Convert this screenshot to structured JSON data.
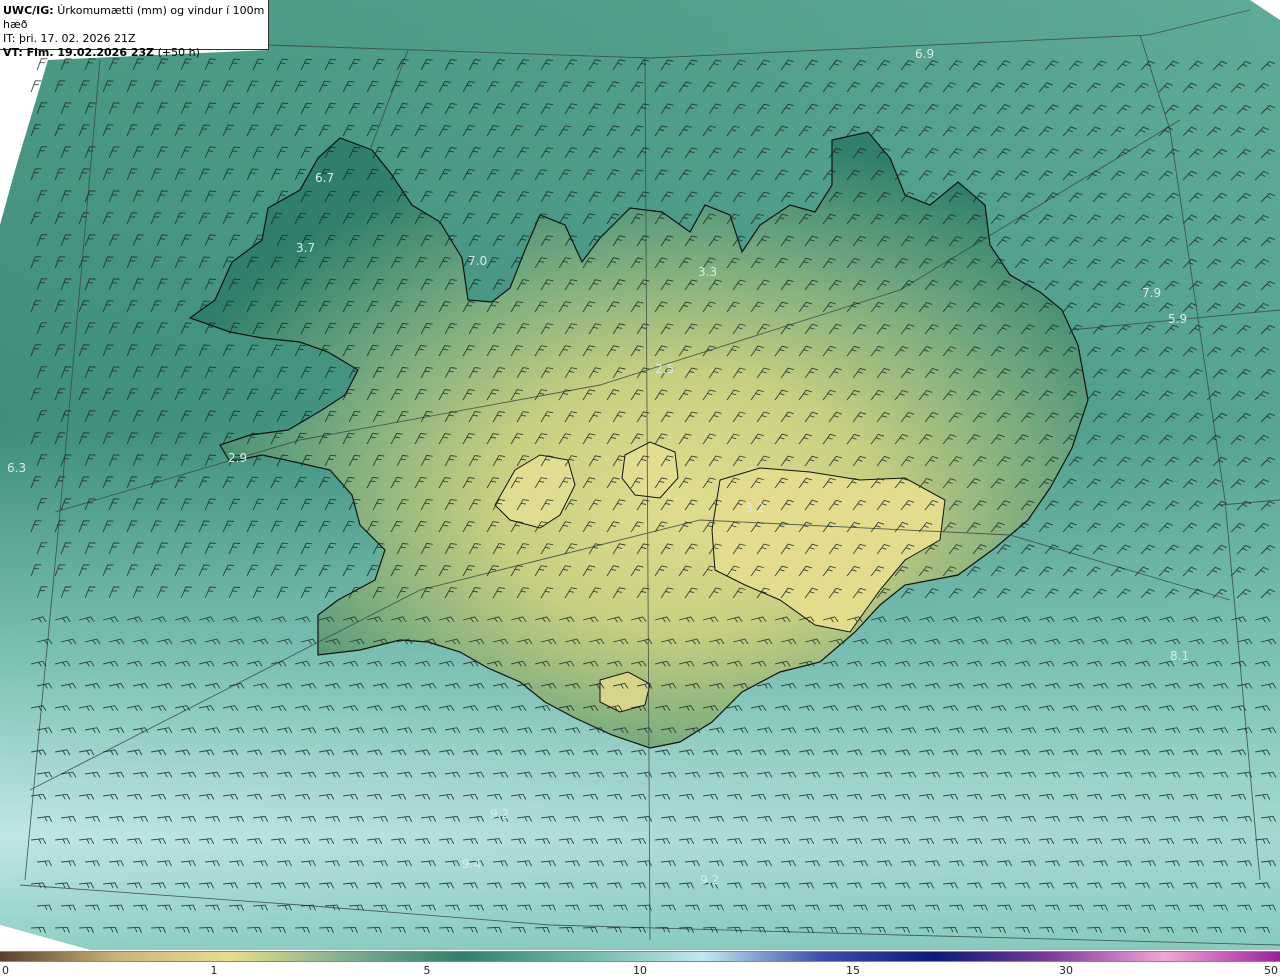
{
  "header": {
    "model": "UWC/IG:",
    "title": "Úrkomumætti (mm) og vindur í 100m hæð",
    "it_label": "IT:",
    "it_value": "þri. 17. 02. 2026 21Z",
    "vt_label": "VT: Fim. 19.02.2026 23Z",
    "vt_extra": "(+50 h)"
  },
  "map_labels": [
    {
      "text": "6.9"
    },
    {
      "text": "6.7"
    },
    {
      "text": "3.7"
    },
    {
      "text": "7.0"
    },
    {
      "text": "3.3"
    },
    {
      "text": "2.5"
    },
    {
      "text": "2.9"
    },
    {
      "text": "6.3"
    },
    {
      "text": "7.9"
    },
    {
      "text": "5.9"
    },
    {
      "text": "8.1"
    },
    {
      "text": "9.2"
    },
    {
      "text": "3.2"
    },
    {
      "text": "9.4"
    },
    {
      "text": "9.2"
    }
  ],
  "colorbar": {
    "ticks": [
      "0",
      "1",
      "5",
      "10",
      "15",
      "30",
      "50"
    ],
    "colors": [
      "#5a3e2b",
      "#c9b37a",
      "#e8de8a",
      "#7fb08f",
      "#2f7f6c",
      "#69b5a6",
      "#bfe9ef",
      "#3f4fb0",
      "#0b1a7a",
      "#7a3b9a",
      "#f3a6d8",
      "#9b1f9b"
    ]
  },
  "colors": {
    "sea_deep": "#3b8c78",
    "sea_light": "#bfe6e6",
    "land_low": "#2f7f6c",
    "land_high": "#d6d98a"
  }
}
